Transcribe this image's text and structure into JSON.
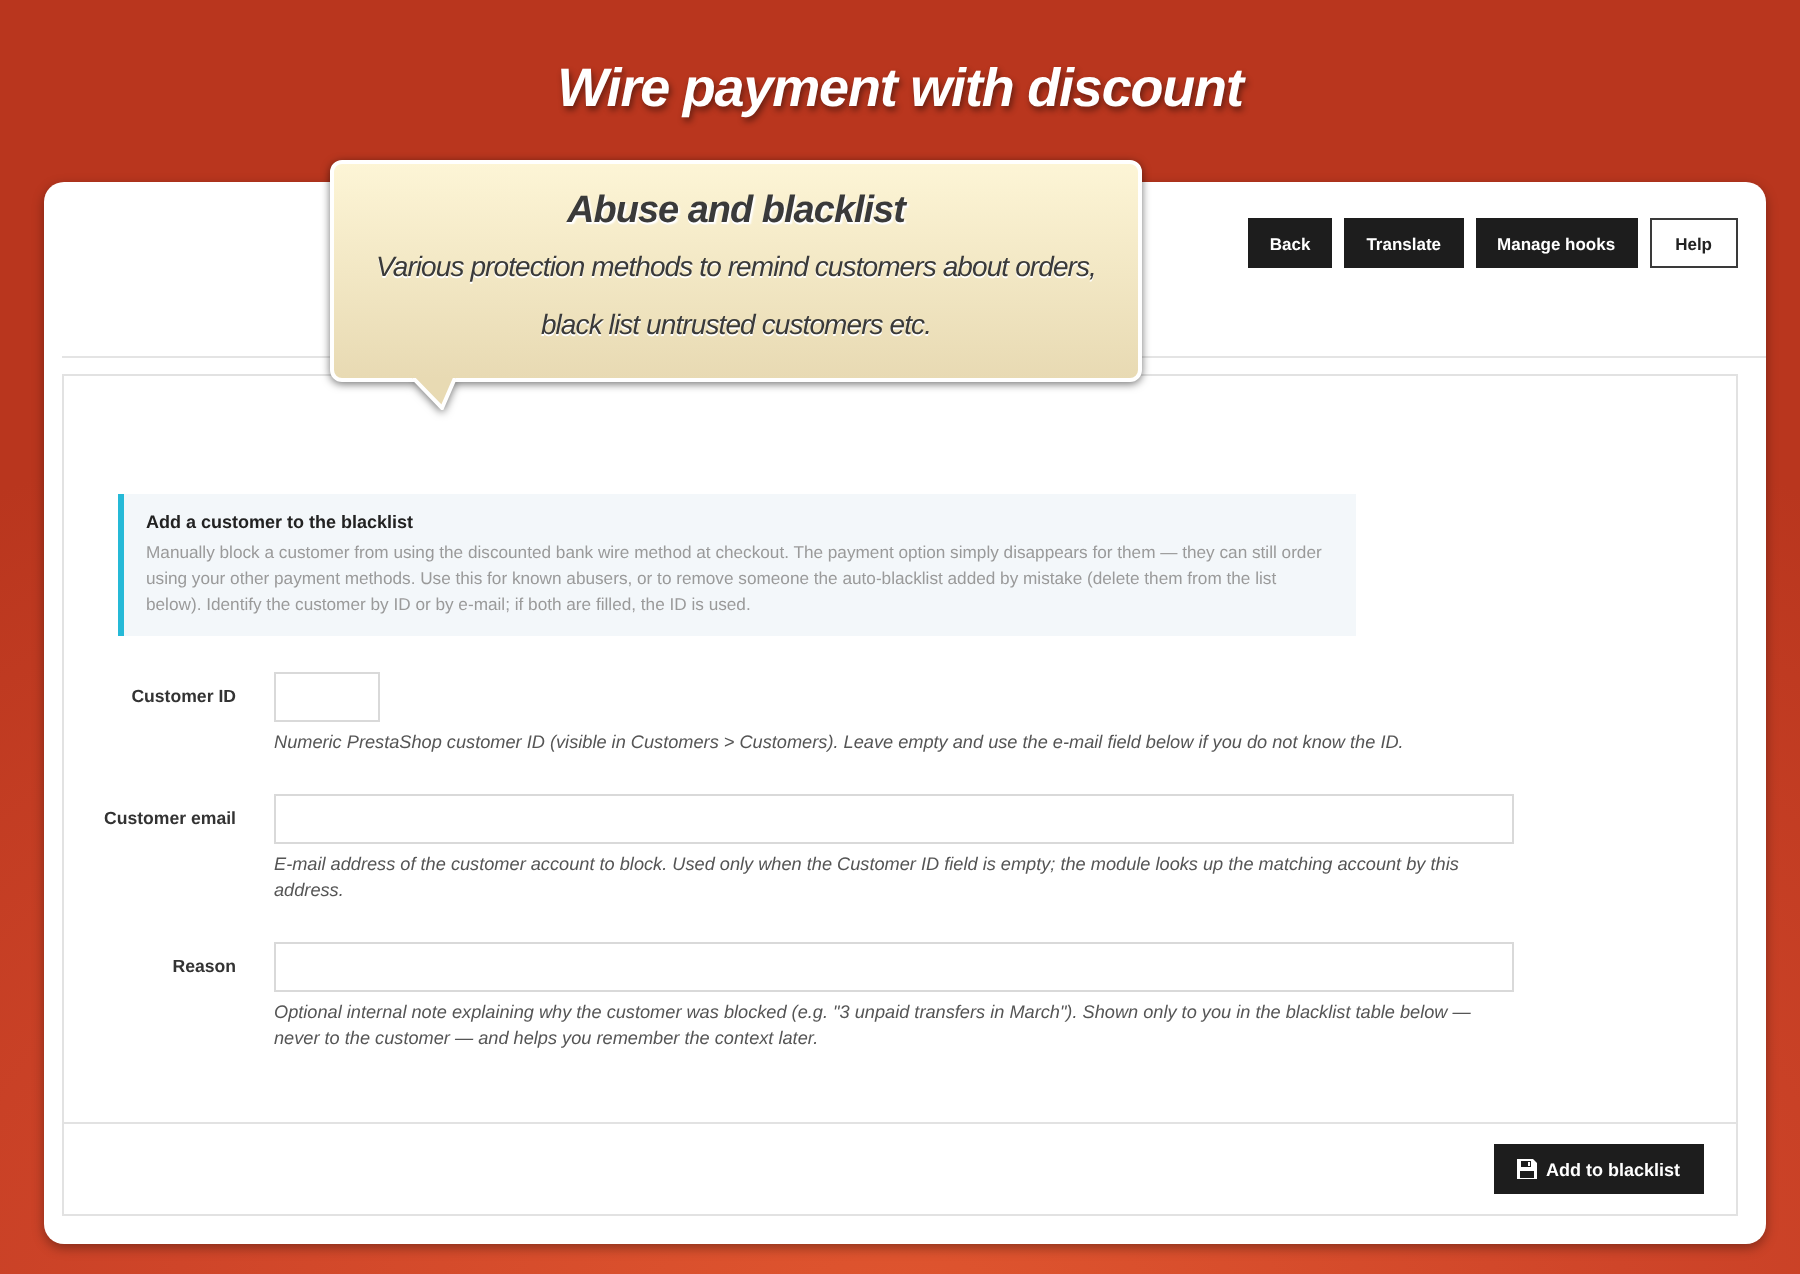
{
  "page_title": "Wire payment with discount",
  "callout": {
    "title": "Abuse and blacklist",
    "text": "Various protection methods to remind customers about orders, black list untrusted customers etc."
  },
  "toolbar": [
    {
      "label": "Back",
      "kind": "dark"
    },
    {
      "label": "Translate",
      "kind": "dark"
    },
    {
      "label": "Manage hooks",
      "kind": "dark"
    },
    {
      "label": "Help",
      "kind": "outline"
    }
  ],
  "info": {
    "title": "Add a customer to the blacklist",
    "text": "Manually block a customer from using the discounted bank wire method at checkout. The payment option simply disappears for them — they can still order using your other payment methods. Use this for known abusers, or to remove someone the auto-blacklist added by mistake (delete them from the list below). Identify the customer by ID or by e-mail; if both are filled, the ID is used."
  },
  "form": {
    "fields": [
      {
        "label": "Customer ID",
        "kind": "number",
        "help": "Numeric PrestaShop customer ID (visible in Customers > Customers). Leave empty and use the e-mail field below if you do not know the ID."
      },
      {
        "label": "Customer email",
        "kind": "text",
        "help": "E-mail address of the customer account to block. Used only when the Customer ID field is empty; the module looks up the matching account by this address."
      },
      {
        "label": "Reason",
        "kind": "text",
        "help": "Optional internal note explaining why the customer was blocked (e.g. \"3 unpaid transfers in March\"). Shown only to you in the blacklist table below — never to the customer — and helps you remember the context later."
      }
    ]
  },
  "footer": {
    "submit": "Add to blacklist"
  }
}
